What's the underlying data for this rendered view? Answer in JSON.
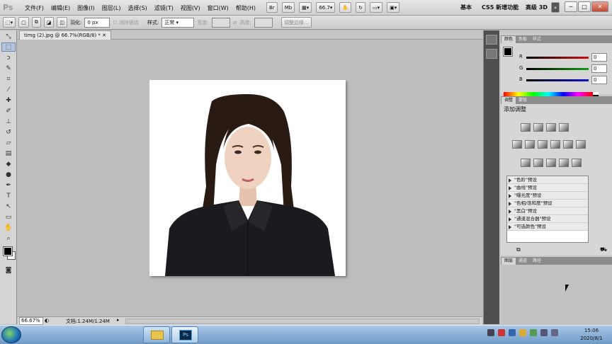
{
  "app": {
    "logo": "Ps"
  },
  "menu": [
    "文件(F)",
    "编辑(E)",
    "图像(I)",
    "图层(L)",
    "选择(S)",
    "滤镜(T)",
    "视图(V)",
    "窗口(W)",
    "帮助(H)"
  ],
  "menubar_tools": {
    "br": "Br",
    "mb": "Mb",
    "zoom": "66.7"
  },
  "workspaces": {
    "basic": "基本",
    "new": "CS5 新增功能",
    "adv3d": "高级 3D"
  },
  "options": {
    "feather_label": "羽化:",
    "feather_value": "0 px",
    "antialias": "消除锯齿",
    "style_label": "样式:",
    "style_value": "正常",
    "width_label": "宽度:",
    "height_label": "高度:",
    "refine_edge": "调整边缘..."
  },
  "document": {
    "tab_title": "timg (2).jpg @ 66.7%(RGB/8) *"
  },
  "status": {
    "zoom": "66.67%",
    "doc_size": "文档:1.24M/1.24M"
  },
  "color_panel": {
    "tabs": [
      "颜色",
      "色板",
      "样式"
    ],
    "channels": [
      {
        "name": "R",
        "value": "0",
        "color": "#d01010"
      },
      {
        "name": "G",
        "value": "0",
        "color": "#10a010"
      },
      {
        "name": "B",
        "value": "0",
        "color": "#1010d0"
      }
    ]
  },
  "adjust_panel": {
    "tabs": [
      "调整",
      "蒙版"
    ],
    "title": "添加调整",
    "presets": [
      "\"色阶\"预设",
      "\"曲线\"预设",
      "\"曝光度\"预设",
      "\"色相/饱和度\"预设",
      "\"黑白\"预设",
      "\"通道混合器\"预设",
      "\"可选颜色\"预设"
    ]
  },
  "layers_panel": {
    "tabs": [
      "图层",
      "通道",
      "路径"
    ]
  },
  "clock": {
    "time": "15:06",
    "date": "2020/8/1"
  }
}
